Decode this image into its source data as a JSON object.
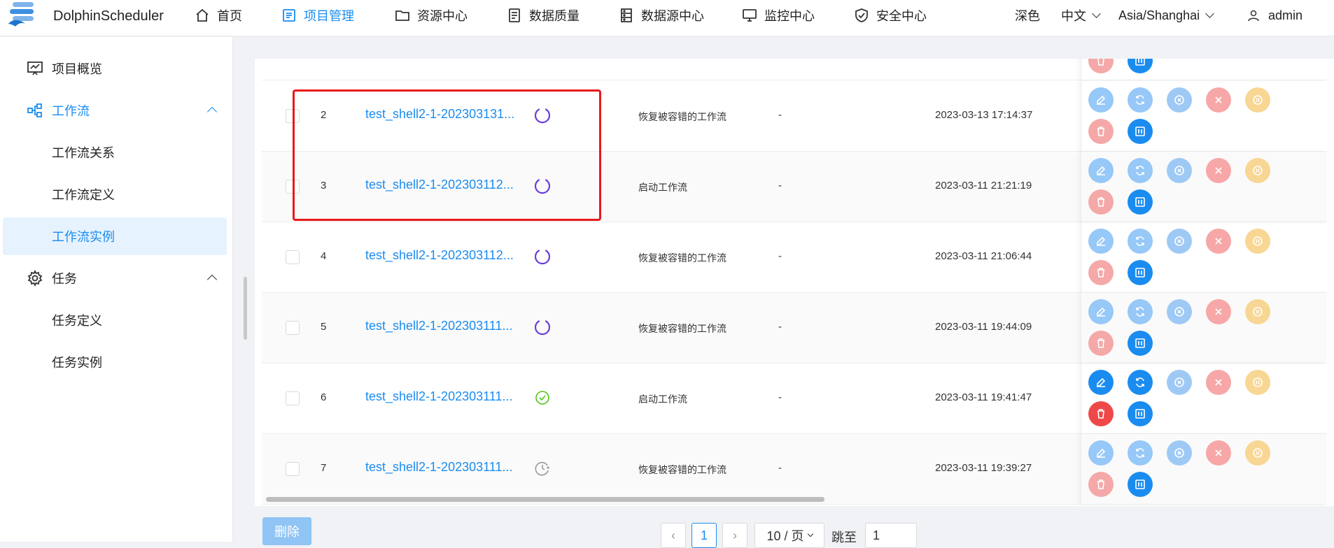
{
  "header": {
    "logo_text": "DolphinScheduler",
    "nav": [
      {
        "label": "首页",
        "icon": "home-icon"
      },
      {
        "label": "项目管理",
        "icon": "project-icon",
        "active": true
      },
      {
        "label": "资源中心",
        "icon": "folder-icon"
      },
      {
        "label": "数据质量",
        "icon": "data-quality-icon"
      },
      {
        "label": "数据源中心",
        "icon": "datasource-icon"
      },
      {
        "label": "监控中心",
        "icon": "monitor-icon"
      },
      {
        "label": "安全中心",
        "icon": "shield-icon"
      }
    ],
    "theme": "深色",
    "language": "中文",
    "timezone": "Asia/Shanghai",
    "user": "admin"
  },
  "sidebar": {
    "items": [
      {
        "label": "项目概览",
        "icon": "overview-icon"
      },
      {
        "label": "工作流",
        "icon": "workflow-icon"
      },
      {
        "label": "工作流关系"
      },
      {
        "label": "工作流定义"
      },
      {
        "label": "工作流实例"
      },
      {
        "label": "任务",
        "icon": "gear-icon"
      },
      {
        "label": "任务定义"
      },
      {
        "label": "任务实例"
      }
    ]
  },
  "table": {
    "rows": [
      {
        "id": "2",
        "name": "test_shell2-1-202303131...",
        "status": "running",
        "run_type": "恢复被容错的工作流",
        "host": "-",
        "time": "2023-03-13 17:14:37"
      },
      {
        "id": "3",
        "name": "test_shell2-1-202303112...",
        "status": "running",
        "run_type": "启动工作流",
        "host": "-",
        "time": "2023-03-11 21:21:19"
      },
      {
        "id": "4",
        "name": "test_shell2-1-202303112...",
        "status": "running",
        "run_type": "恢复被容错的工作流",
        "host": "-",
        "time": "2023-03-11 21:06:44"
      },
      {
        "id": "5",
        "name": "test_shell2-1-202303111...",
        "status": "running",
        "run_type": "恢复被容错的工作流",
        "host": "-",
        "time": "2023-03-11 19:44:09"
      },
      {
        "id": "6",
        "name": "test_shell2-1-202303111...",
        "status": "success",
        "run_type": "启动工作流",
        "host": "-",
        "time": "2023-03-11 19:41:47"
      },
      {
        "id": "7",
        "name": "test_shell2-1-202303111...",
        "status": "waiting",
        "run_type": "恢复被容错的工作流",
        "host": "-",
        "time": "2023-03-11 19:39:27"
      }
    ]
  },
  "footer": {
    "delete_label": "删除",
    "prev": "‹",
    "page": "1",
    "next": "›",
    "page_size": "10 / 页",
    "jump_label": "跳至",
    "jump_value": "1"
  },
  "colors": {
    "accent": "#1a8cf0",
    "highlight": "#e8191c",
    "running": "#6a3fd8",
    "success": "#52c41a"
  }
}
